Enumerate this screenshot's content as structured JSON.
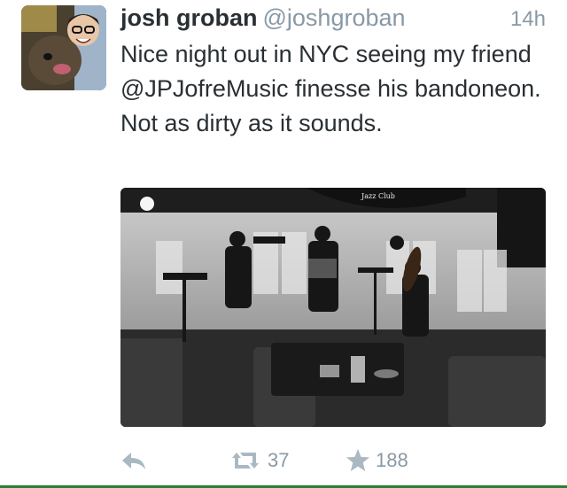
{
  "tweet": {
    "display_name": "josh groban",
    "handle": "@joshgroban",
    "time": "14h",
    "text": "Nice night out in NYC seeing my friend @JPJofreMusic finesse his bandoneon. Not as dirty as it sounds.",
    "photo": {
      "sign_text": "Jazz Club"
    },
    "actions": {
      "reply_icon": "reply-arrow-icon",
      "retweet_icon": "retweet-icon",
      "retweet_count": "37",
      "favorite_icon": "star-icon",
      "favorite_count": "188"
    }
  },
  "colors": {
    "name": "#292f33",
    "secondary": "#8899a6",
    "icon": "#aab8c2",
    "bottom_bar": "#2e7d32"
  }
}
